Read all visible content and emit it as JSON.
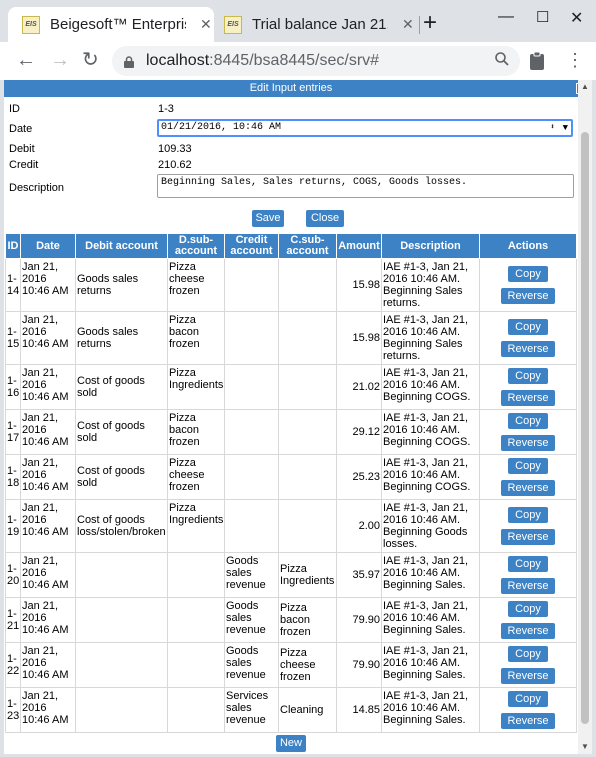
{
  "browser": {
    "tabs": [
      {
        "favicon": "EIS",
        "title": "Beigesoft™ Enterpris",
        "active": true
      },
      {
        "favicon": "EIS",
        "title": "Trial balance Jan 21,",
        "active": false
      }
    ],
    "new_tab": "+",
    "url_host": "localhost",
    "url_path": ":8445/bsa8445/sec/srv#"
  },
  "dialog": {
    "title": "Edit Input entries",
    "close": "x",
    "fields": {
      "id_label": "ID",
      "id_value": "1-3",
      "date_label": "Date",
      "date_value": "01/21/2016, 10:46 AM",
      "debit_label": "Debit",
      "debit_value": "109.33",
      "credit_label": "Credit",
      "credit_value": "210.62",
      "desc_label": "Description",
      "desc_value": "Beginning Sales, Sales returns, COGS, Goods losses."
    },
    "save_label": "Save",
    "close_label": "Close"
  },
  "table": {
    "headers": [
      "ID",
      "Date",
      "Debit account",
      "D.sub-account",
      "Credit account",
      "C.sub-account",
      "Amount",
      "Description",
      "Actions"
    ],
    "copy_label": "Copy",
    "reverse_label": "Reverse",
    "rows": [
      {
        "id": "1-14",
        "date": "Jan 21, 2016 10:46 AM",
        "debit": "Goods sales returns",
        "dsub": "Pizza cheese frozen",
        "credit": "",
        "csub": "",
        "amount": "15.98",
        "desc": "IAE #1-3, Jan 21, 2016 10:46 AM. Beginning Sales returns."
      },
      {
        "id": "1-15",
        "date": "Jan 21, 2016 10:46 AM",
        "debit": "Goods sales returns",
        "dsub": "Pizza bacon frozen",
        "credit": "",
        "csub": "",
        "amount": "15.98",
        "desc": "IAE #1-3, Jan 21, 2016 10:46 AM. Beginning Sales returns."
      },
      {
        "id": "1-16",
        "date": "Jan 21, 2016 10:46 AM",
        "debit": "Cost of goods sold",
        "dsub": "Pizza Ingredients",
        "credit": "",
        "csub": "",
        "amount": "21.02",
        "desc": "IAE #1-3, Jan 21, 2016 10:46 AM. Beginning COGS."
      },
      {
        "id": "1-17",
        "date": "Jan 21, 2016 10:46 AM",
        "debit": "Cost of goods sold",
        "dsub": "Pizza bacon frozen",
        "credit": "",
        "csub": "",
        "amount": "29.12",
        "desc": "IAE #1-3, Jan 21, 2016 10:46 AM. Beginning COGS."
      },
      {
        "id": "1-18",
        "date": "Jan 21, 2016 10:46 AM",
        "debit": "Cost of goods sold",
        "dsub": "Pizza cheese frozen",
        "credit": "",
        "csub": "",
        "amount": "25.23",
        "desc": "IAE #1-3, Jan 21, 2016 10:46 AM. Beginning COGS."
      },
      {
        "id": "1-19",
        "date": "Jan 21, 2016 10:46 AM",
        "debit": "Cost of goods loss/stolen/broken",
        "dsub": "Pizza Ingredients",
        "credit": "",
        "csub": "",
        "amount": "2.00",
        "desc": "IAE #1-3, Jan 21, 2016 10:46 AM. Beginning Goods losses."
      },
      {
        "id": "1-20",
        "date": "Jan 21, 2016 10:46 AM",
        "debit": "",
        "dsub": "",
        "credit": "Goods sales revenue",
        "csub": "Pizza Ingredients",
        "amount": "35.97",
        "desc": "IAE #1-3, Jan 21, 2016 10:46 AM. Beginning Sales."
      },
      {
        "id": "1-21",
        "date": "Jan 21, 2016 10:46 AM",
        "debit": "",
        "dsub": "",
        "credit": "Goods sales revenue",
        "csub": "Pizza bacon frozen",
        "amount": "79.90",
        "desc": "IAE #1-3, Jan 21, 2016 10:46 AM. Beginning Sales."
      },
      {
        "id": "1-22",
        "date": "Jan 21, 2016 10:46 AM",
        "debit": "",
        "dsub": "",
        "credit": "Goods sales revenue",
        "csub": "Pizza cheese frozen",
        "amount": "79.90",
        "desc": "IAE #1-3, Jan 21, 2016 10:46 AM. Beginning Sales."
      },
      {
        "id": "1-23",
        "date": "Jan 21, 2016 10:46 AM",
        "debit": "",
        "dsub": "",
        "credit": "Services sales revenue",
        "csub": "Cleaning",
        "amount": "14.85",
        "desc": "IAE #1-3, Jan 21, 2016 10:46 AM. Beginning Sales."
      }
    ]
  },
  "new_label": "New",
  "colors": {
    "accent": "#3c82c4"
  }
}
